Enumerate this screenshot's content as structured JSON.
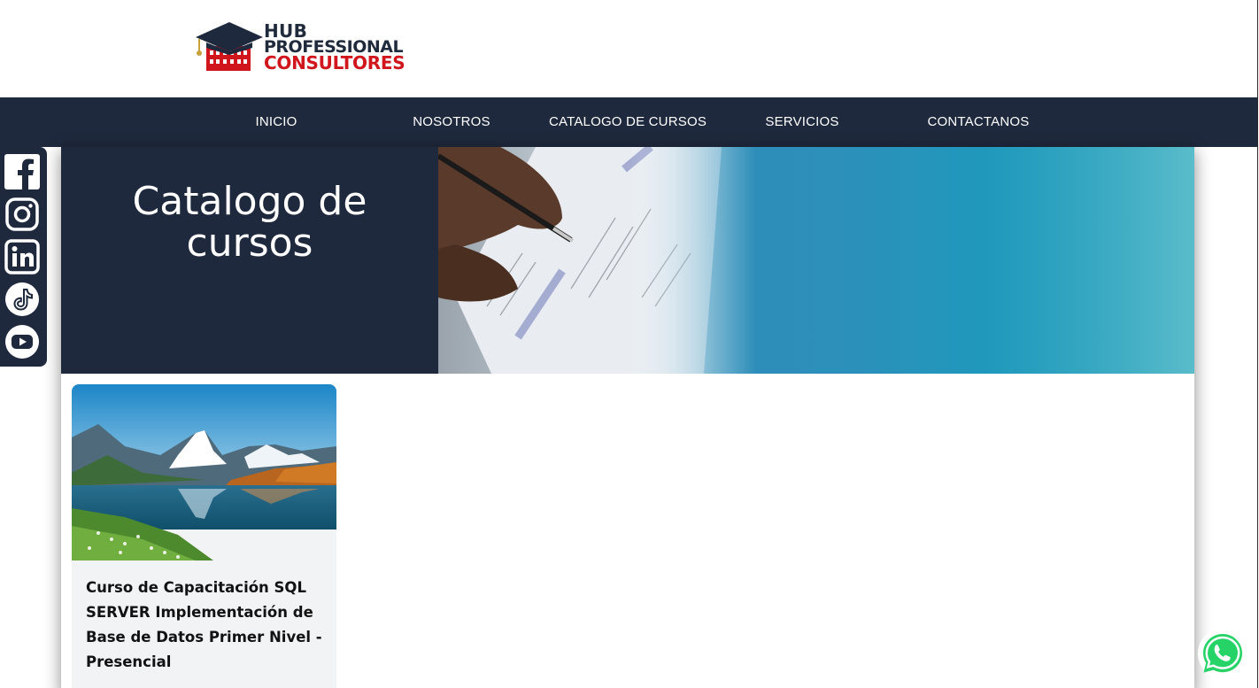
{
  "brand": {
    "line1": "HUB",
    "line2": "PROFESSIONAL",
    "line3": "CONSULTORES",
    "colors": {
      "navy": "#1f293d",
      "red": "#d0161c"
    }
  },
  "nav": {
    "items": [
      {
        "label": "INICIO"
      },
      {
        "label": "NOSOTROS"
      },
      {
        "label": "CATALOGO DE CURSOS"
      },
      {
        "label": "SERVICIOS"
      },
      {
        "label": "CONTACTANOS"
      }
    ]
  },
  "social": {
    "icons": [
      "facebook-icon",
      "instagram-icon",
      "linkedin-icon",
      "tiktok-icon",
      "youtube-icon"
    ]
  },
  "hero": {
    "title_line1": "Catalogo de",
    "title_line2": "cursos"
  },
  "courses": [
    {
      "title": "Curso de Capacitación SQL SERVER Implementación de Base de Datos Primer Nivel - Presencial"
    }
  ],
  "whatsapp": {
    "icon": "whatsapp-icon",
    "color": "#25d366"
  }
}
